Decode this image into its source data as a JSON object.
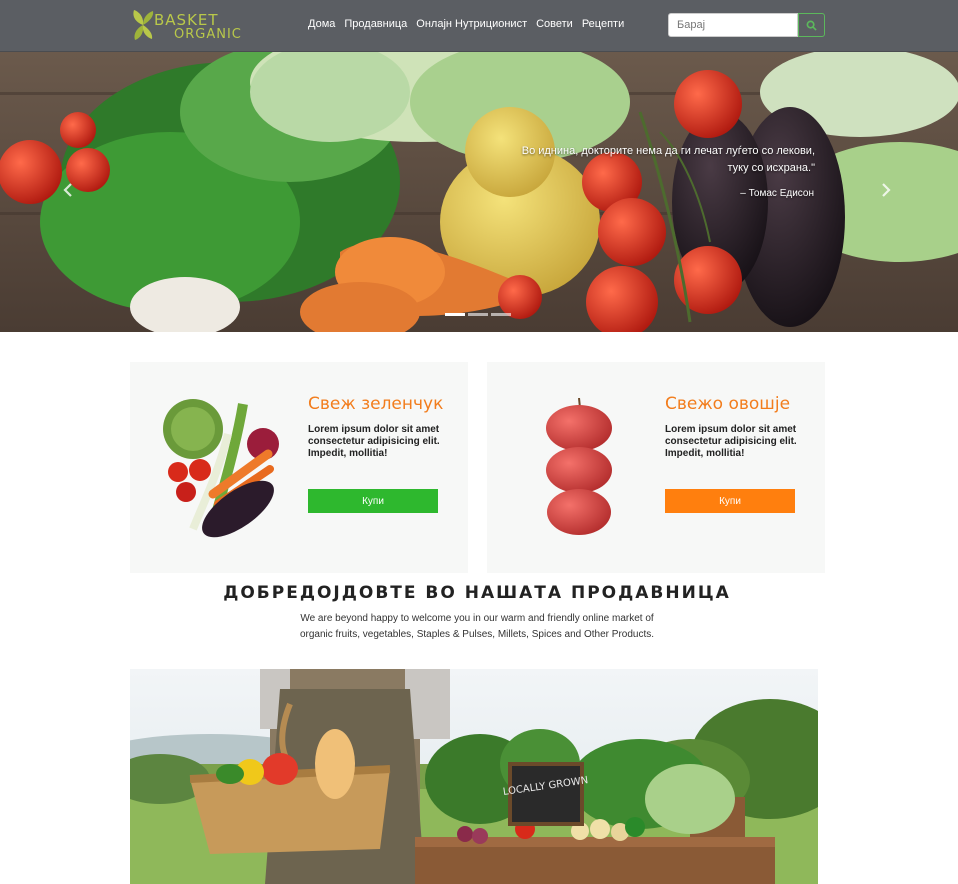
{
  "brand": {
    "line1": "BASKET",
    "line2": "ORGANIC"
  },
  "nav": [
    "Дома",
    "Продавница",
    "Онлајн Нутриционист",
    "Совети",
    "Рецепти"
  ],
  "search": {
    "placeholder": "Барај"
  },
  "hero": {
    "quote_line1": "Во иднина, докторите нема да ги лечат луѓето со лекови,",
    "quote_line2": "туку со исхрана.\"",
    "author": "– Томас Едисон",
    "slides": 3
  },
  "cards": [
    {
      "title": "Свеж зеленчук",
      "text": "Lorem ipsum dolor sit amet consectetur adipisicing elit. Impedit, mollitia!",
      "button": "Купи",
      "button_color": "#2eb82e"
    },
    {
      "title": "Свежо овошје",
      "text": "Lorem ipsum dolor sit amet consectetur adipisicing elit. Impedit, mollitia!",
      "button": "Купи",
      "button_color": "#ff7f0e"
    }
  ],
  "welcome": {
    "title": "ДОБРЕДОЈДОВТЕ ВО НАШАТА ПРОДАВНИЦА",
    "text": "We are beyond happy to welcome you in our warm and friendly online market of organic fruits, vegetables, Staples & Pulses, Millets, Spices and Other Products."
  },
  "sign": {
    "text": "LOCALLY GROWN"
  },
  "colors": {
    "navbar": "#5b5e63",
    "accent_orange": "#f27d1d",
    "accent_green": "#2eb82e",
    "logo": "#b9c84a"
  },
  "icons": {
    "search": "search-icon",
    "prev": "chevron-left-icon",
    "next": "chevron-right-icon"
  }
}
